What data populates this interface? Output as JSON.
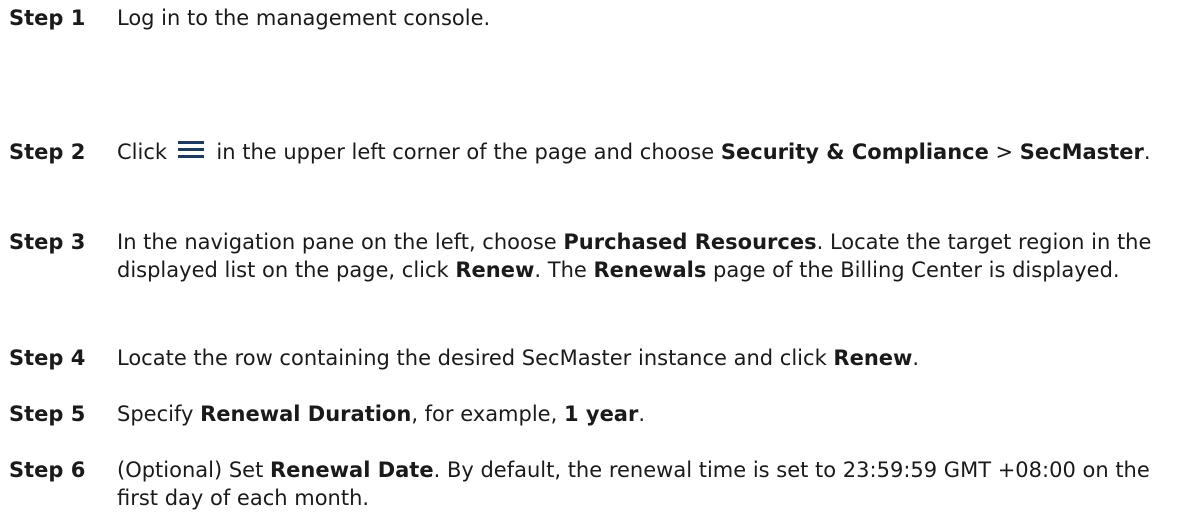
{
  "steps": [
    {
      "label": "Step 1",
      "parts": [
        {
          "t": "Log in to the management console."
        }
      ]
    },
    {
      "label": "Step 2",
      "parts": [
        {
          "t": "Click "
        },
        {
          "icon": "menu-icon"
        },
        {
          "t": " in the upper left corner of the page and choose "
        },
        {
          "b": "Security & Compliance"
        },
        {
          "t": " > "
        },
        {
          "b": "SecMaster"
        },
        {
          "t": "."
        }
      ]
    },
    {
      "label": "Step 3",
      "parts": [
        {
          "t": "In the navigation pane on the left, choose "
        },
        {
          "b": "Purchased Resources"
        },
        {
          "t": ". Locate the target region in the displayed list on the page, click "
        },
        {
          "b": "Renew"
        },
        {
          "t": ". The "
        },
        {
          "b": "Renewals"
        },
        {
          "t": " page of the Billing Center is displayed."
        }
      ]
    },
    {
      "label": "Step 4",
      "parts": [
        {
          "t": "Locate the row containing the desired SecMaster instance and click "
        },
        {
          "b": "Renew"
        },
        {
          "t": "."
        }
      ]
    },
    {
      "label": "Step 5",
      "parts": [
        {
          "t": "Specify "
        },
        {
          "b": "Renewal Duration"
        },
        {
          "t": ", for example, "
        },
        {
          "b": "1 year"
        },
        {
          "t": "."
        }
      ]
    },
    {
      "label": "Step 6",
      "parts": [
        {
          "t": "(Optional) Set "
        },
        {
          "b": "Renewal Date"
        },
        {
          "t": ". By default, the renewal time is set to 23:59:59 GMT +08:00 on the first day of each month."
        }
      ]
    }
  ]
}
